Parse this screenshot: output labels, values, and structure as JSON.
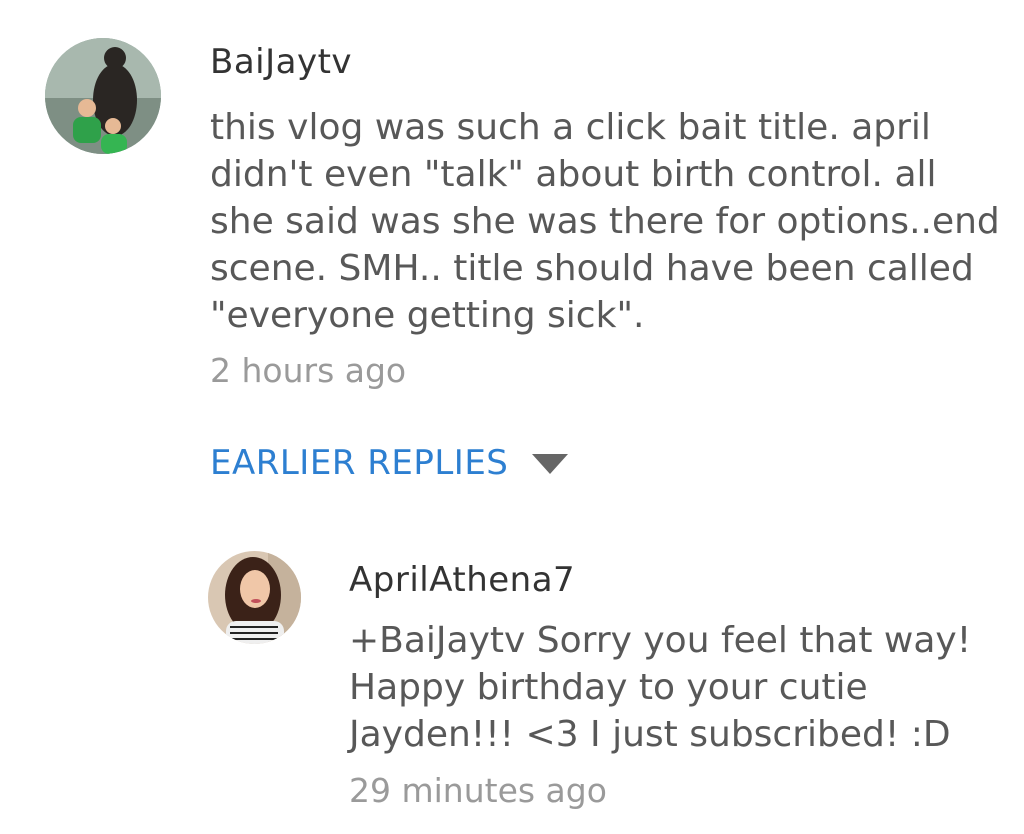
{
  "comments": [
    {
      "author": "BaiJaytv",
      "text": "this vlog was such a click bait title. april\ndidn't even \"talk\" about birth control. all\nshe said was she was there for options..end\nscene. SMH.. title should have been called\n\"everyone getting sick\".",
      "time": "2 hours ago",
      "avatar_icon": "avatar-two-kids-bear"
    }
  ],
  "earlier_replies": {
    "label": "EARLIER REPLIES",
    "icon": "caret-down-icon",
    "color": "#2d7fd1"
  },
  "replies": [
    {
      "author": "AprilAthena7",
      "text": "+BaiJaytv Sorry you feel that way!\nHappy birthday to your cutie\nJayden!!! <3 I just subscribed! :D",
      "time": "29 minutes ago",
      "avatar_icon": "avatar-woman-portrait"
    }
  ]
}
